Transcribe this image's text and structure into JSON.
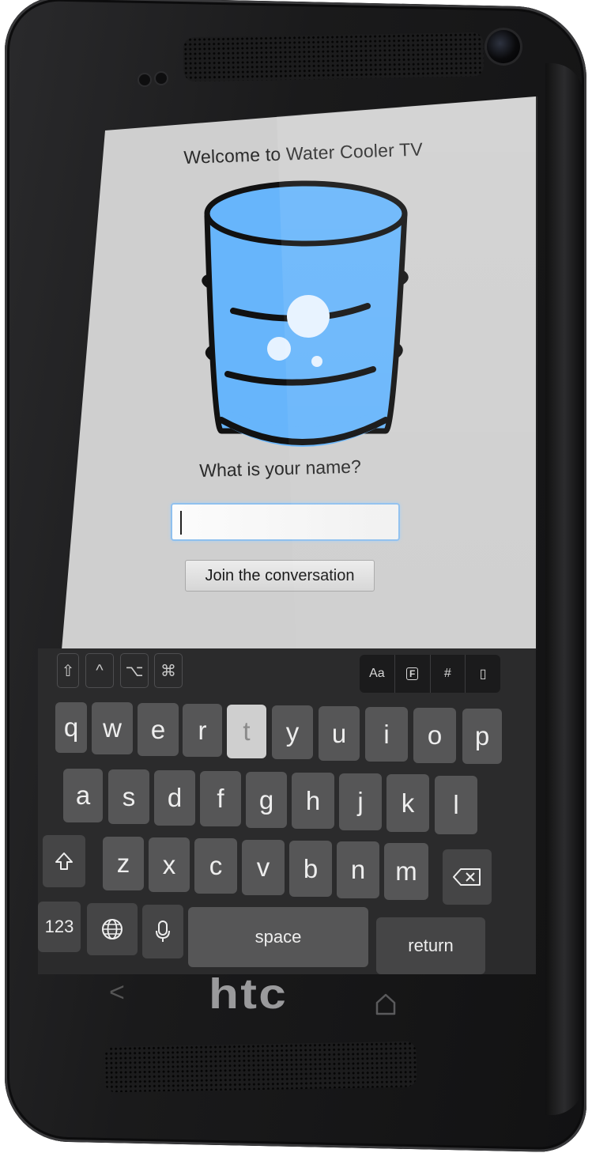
{
  "app": {
    "welcome": "Welcome to Water Cooler TV",
    "prompt": "What is your name?",
    "name_input": {
      "value": "",
      "placeholder": ""
    },
    "join_button": "Join the conversation"
  },
  "keyboard": {
    "toolbar_left": [
      "⇧",
      "^",
      "⌥",
      "⌘"
    ],
    "toolbar_right": [
      "Aa",
      "F",
      "#",
      "▯"
    ],
    "row1": [
      "q",
      "w",
      "e",
      "r",
      "t",
      "y",
      "u",
      "i",
      "o",
      "p"
    ],
    "row2": [
      "a",
      "s",
      "d",
      "f",
      "g",
      "h",
      "j",
      "k",
      "l"
    ],
    "row3": [
      "z",
      "x",
      "c",
      "v",
      "b",
      "n",
      "m"
    ],
    "pressed_key": "t",
    "numbers_key": "123",
    "space_key": "space",
    "return_key": "return"
  },
  "device": {
    "brand": "htc"
  },
  "colors": {
    "screen_bg": "#cfcfcf",
    "cooler_blue": "#67b5fb",
    "keyboard_bg": "#2b2b2c",
    "key_bg": "#565657"
  }
}
